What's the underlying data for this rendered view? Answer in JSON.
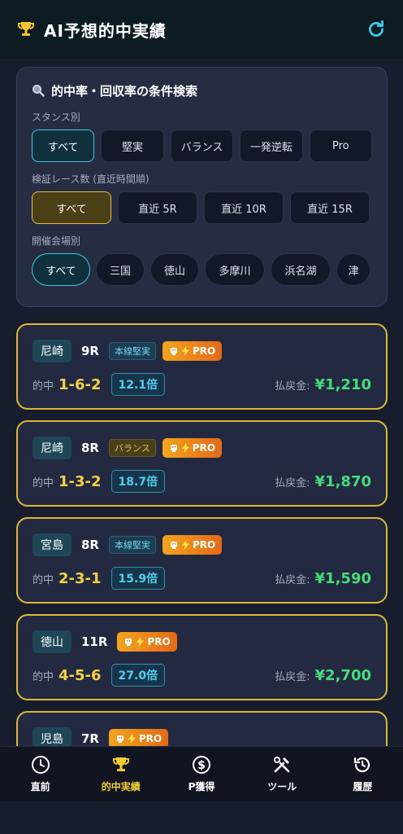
{
  "header": {
    "title": "AI予想的中実績",
    "trophy_icon": "trophy-icon",
    "refresh_icon": "refresh-icon"
  },
  "filter": {
    "title": "的中率・回収率の条件検索",
    "stance_label": "スタンス別",
    "stance_options": [
      "すべて",
      "堅実",
      "バランス",
      "一発逆転",
      "Pro"
    ],
    "race_count_label": "検証レース数 (直近時間順)",
    "race_count_options": [
      "すべて",
      "直近 5R",
      "直近 10R",
      "直近 15R"
    ],
    "venue_label": "開催会場別",
    "venue_options": [
      "すべて",
      "三国",
      "徳山",
      "多摩川",
      "浜名湖",
      "津"
    ]
  },
  "common": {
    "hit_label": "的中",
    "payout_label": "払戻金:",
    "pro_label": "PRO"
  },
  "cards": [
    {
      "venue": "尼崎",
      "race": "9R",
      "tag": "本線堅実",
      "combo": "1-6-2",
      "odds": "12.1倍",
      "payout": "¥1,210"
    },
    {
      "venue": "尼崎",
      "race": "8R",
      "tag": "バランス",
      "combo": "1-3-2",
      "odds": "18.7倍",
      "payout": "¥1,870"
    },
    {
      "venue": "宮島",
      "race": "8R",
      "tag": "本線堅実",
      "combo": "2-3-1",
      "odds": "15.9倍",
      "payout": "¥1,590"
    },
    {
      "venue": "徳山",
      "race": "11R",
      "tag": "",
      "combo": "4-5-6",
      "odds": "27.0倍",
      "payout": "¥2,700"
    },
    {
      "venue": "児島",
      "race": "7R",
      "tag": "",
      "combo": "",
      "odds": "",
      "payout": ""
    }
  ],
  "nav": [
    {
      "label": "直前",
      "icon": "clock-icon"
    },
    {
      "label": "的中実績",
      "icon": "trophy-icon"
    },
    {
      "label": "P獲得",
      "icon": "dollar-coin-icon"
    },
    {
      "label": "ツール",
      "icon": "tools-icon"
    },
    {
      "label": "履歴",
      "icon": "history-icon"
    }
  ],
  "colors": {
    "accent_cyan": "#3fc8e4",
    "accent_gold": "#f3d046",
    "payout_green": "#45dc7a",
    "pro_orange": "#f2a51d"
  }
}
